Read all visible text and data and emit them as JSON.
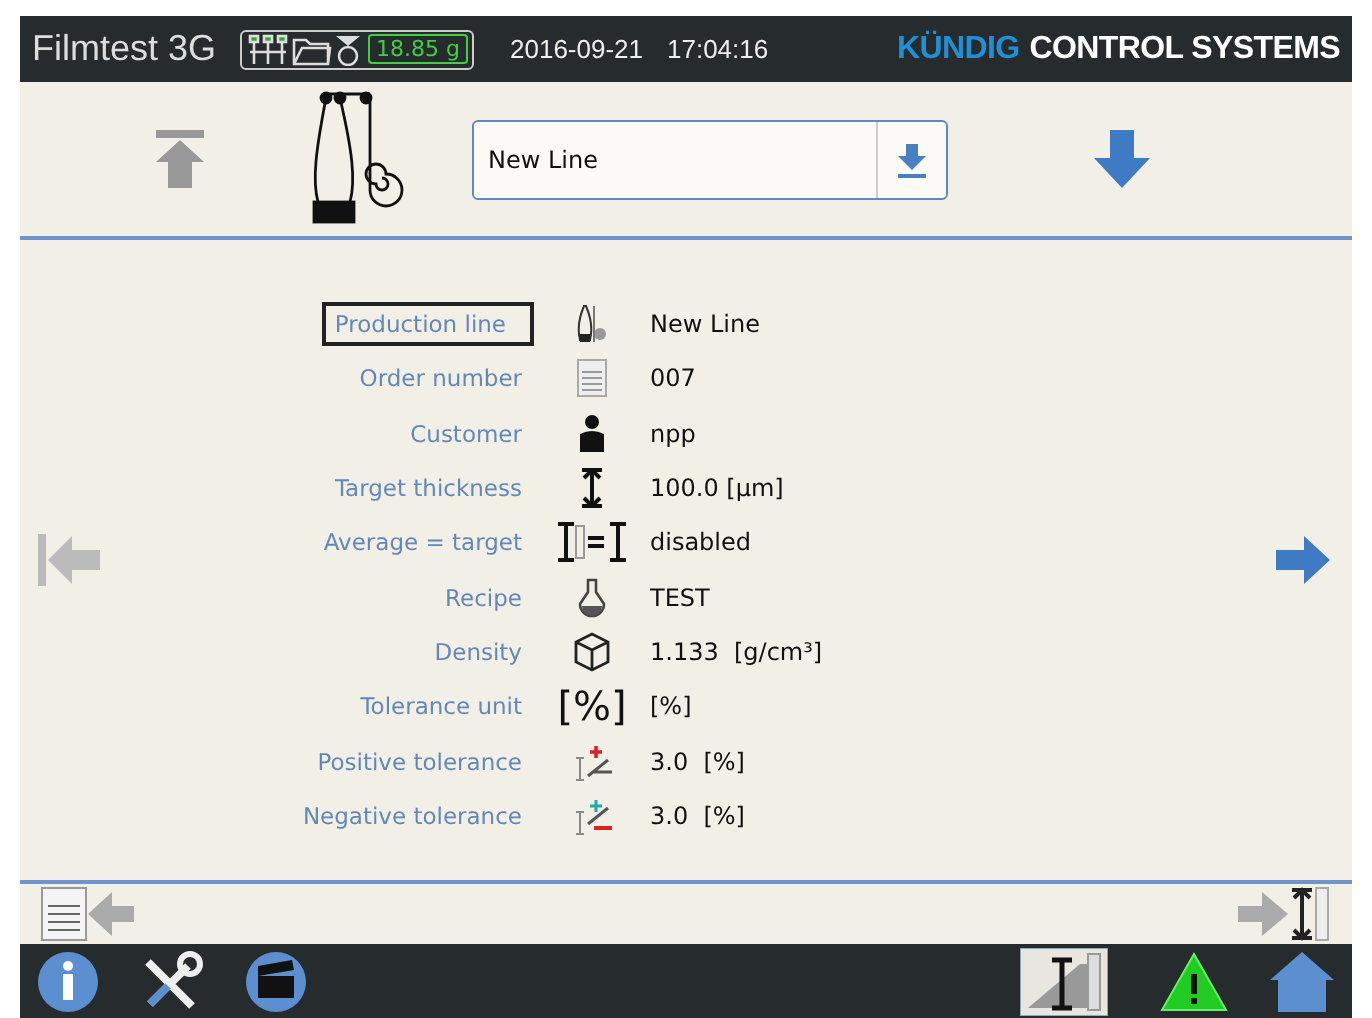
{
  "header": {
    "title": "Filmtest 3G",
    "weight": "18.85 g",
    "date": "2016-09-21",
    "time": "17:04:16",
    "logo_brand": "KÜNDIG",
    "logo_rest": "CONTROL SYSTEMS"
  },
  "line_select": {
    "value": "New Line"
  },
  "fields": [
    {
      "label": "Production line",
      "kind": "line",
      "value": "New Line",
      "selected": true
    },
    {
      "label": "Order number",
      "kind": "order",
      "value": "007",
      "selected": false
    },
    {
      "label": "Customer",
      "kind": "customer",
      "value": "npp",
      "selected": false
    },
    {
      "label": "Target thickness",
      "kind": "thickness",
      "value": "100.0 [µm]",
      "selected": false
    },
    {
      "label": "Average = target",
      "kind": "average",
      "value": "disabled",
      "selected": false
    },
    {
      "label": "Recipe",
      "kind": "recipe",
      "value": "TEST",
      "selected": false
    },
    {
      "label": "Density",
      "kind": "density",
      "value": "1.133  [g/cm³]",
      "selected": false
    },
    {
      "label": "Tolerance unit",
      "kind": "unit",
      "icon_text": "[%]",
      "value": "[%]",
      "selected": false
    },
    {
      "label": "Positive tolerance",
      "kind": "postol",
      "value": "3.0  [%]",
      "selected": false
    },
    {
      "label": "Negative tolerance",
      "kind": "negtol",
      "value": "3.0  [%]",
      "selected": false
    }
  ]
}
